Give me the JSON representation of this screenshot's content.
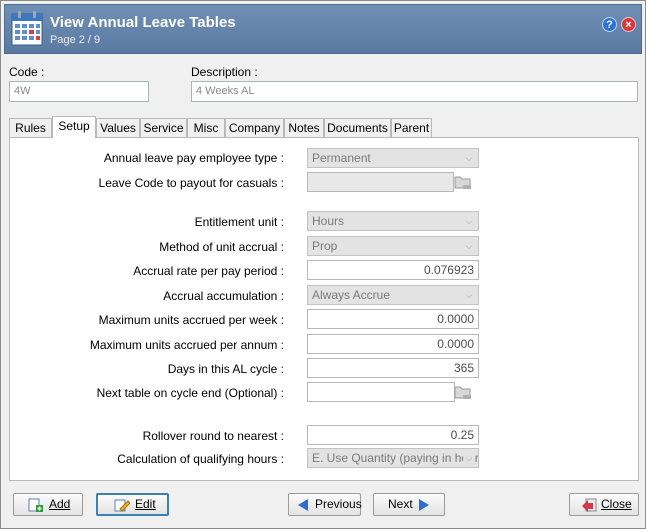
{
  "window": {
    "title": "View Annual Leave Tables",
    "page_indicator": "Page 2 / 9"
  },
  "header": {
    "code_label": "Code :",
    "code_value": "4W",
    "description_label": "Description :",
    "description_value": "4 Weeks AL"
  },
  "tabs": [
    "Rules",
    "Setup",
    "Values",
    "Service",
    "Misc",
    "Company",
    "Notes",
    "Documents",
    "Parent"
  ],
  "active_tab": "Setup",
  "setup": {
    "pay_employee_type_label": "Annual leave pay employee type :",
    "pay_employee_type_value": "Permanent",
    "payout_casuals_label": "Leave Code to payout for casuals :",
    "payout_casuals_value": "",
    "entitlement_unit_label": "Entitlement unit :",
    "entitlement_unit_value": "Hours",
    "accrual_method_label": "Method of unit accrual :",
    "accrual_method_value": "Prop",
    "accrual_rate_label": "Accrual rate per pay period :",
    "accrual_rate_value": "0.076923",
    "accrual_accumulation_label": "Accrual accumulation :",
    "accrual_accumulation_value": "Always Accrue",
    "max_per_week_label": "Maximum units accrued per week :",
    "max_per_week_value": "0.0000",
    "max_per_annum_label": "Maximum units accrued per annum :",
    "max_per_annum_value": "0.0000",
    "days_cycle_label": "Days in this AL cycle :",
    "days_cycle_value": "365",
    "next_table_label": "Next table on cycle end (Optional) :",
    "next_table_value": "",
    "rollover_label": "Rollover round to nearest :",
    "rollover_value": "0.25",
    "qualifying_hours_label": "Calculation of qualifying hours :",
    "qualifying_hours_value": "E. Use Quantity (paying in hours"
  },
  "buttons": {
    "add": "Add",
    "edit": "Edit",
    "previous": "Previous",
    "next": "Next",
    "close": "Close"
  },
  "icons": {
    "app": "calendar-icon",
    "help": "help-icon",
    "close": "close-icon",
    "lookup": "folder-lookup-icon"
  },
  "colors": {
    "titlebar": "#6482aa",
    "focus": "#3c7fb1"
  }
}
